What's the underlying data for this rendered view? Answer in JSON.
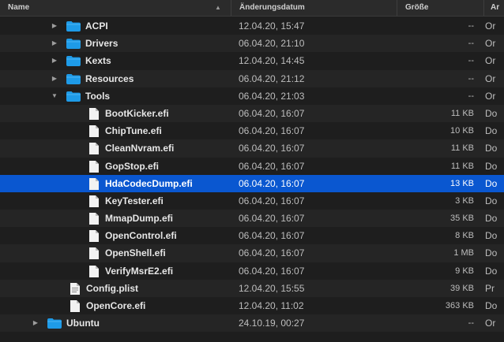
{
  "header": {
    "name": "Name",
    "date": "Änderungsdatum",
    "size": "Größe",
    "kind": "Ar"
  },
  "colors": {
    "background": "#1e1e1e",
    "selection": "#0a57d0",
    "folder": "#1e9be8"
  },
  "rows": [
    {
      "name": "ACPI",
      "date": "12.04.20, 15:47",
      "size": "--",
      "kind": "Or",
      "icon": "folder-icon",
      "disclosure": "collapsed"
    },
    {
      "name": "Drivers",
      "date": "06.04.20, 21:10",
      "size": "--",
      "kind": "Or",
      "icon": "folder-icon",
      "disclosure": "collapsed"
    },
    {
      "name": "Kexts",
      "date": "12.04.20, 14:45",
      "size": "--",
      "kind": "Or",
      "icon": "folder-icon",
      "disclosure": "collapsed"
    },
    {
      "name": "Resources",
      "date": "06.04.20, 21:12",
      "size": "--",
      "kind": "Or",
      "icon": "folder-icon",
      "disclosure": "collapsed"
    },
    {
      "name": "Tools",
      "date": "06.04.20, 21:03",
      "size": "--",
      "kind": "Or",
      "icon": "folder-icon",
      "disclosure": "expanded"
    },
    {
      "name": "BootKicker.efi",
      "date": "06.04.20, 16:07",
      "size": "11 KB",
      "kind": "Do",
      "icon": "document-icon"
    },
    {
      "name": "ChipTune.efi",
      "date": "06.04.20, 16:07",
      "size": "10 KB",
      "kind": "Do",
      "icon": "document-icon"
    },
    {
      "name": "CleanNvram.efi",
      "date": "06.04.20, 16:07",
      "size": "11 KB",
      "kind": "Do",
      "icon": "document-icon"
    },
    {
      "name": "GopStop.efi",
      "date": "06.04.20, 16:07",
      "size": "11 KB",
      "kind": "Do",
      "icon": "document-icon"
    },
    {
      "name": "HdaCodecDump.efi",
      "date": "06.04.20, 16:07",
      "size": "13 KB",
      "kind": "Do",
      "icon": "document-icon",
      "selected": true
    },
    {
      "name": "KeyTester.efi",
      "date": "06.04.20, 16:07",
      "size": "3 KB",
      "kind": "Do",
      "icon": "document-icon"
    },
    {
      "name": "MmapDump.efi",
      "date": "06.04.20, 16:07",
      "size": "35 KB",
      "kind": "Do",
      "icon": "document-icon"
    },
    {
      "name": "OpenControl.efi",
      "date": "06.04.20, 16:07",
      "size": "8 KB",
      "kind": "Do",
      "icon": "document-icon"
    },
    {
      "name": "OpenShell.efi",
      "date": "06.04.20, 16:07",
      "size": "1 MB",
      "kind": "Do",
      "icon": "document-icon"
    },
    {
      "name": "VerifyMsrE2.efi",
      "date": "06.04.20, 16:07",
      "size": "9 KB",
      "kind": "Do",
      "icon": "document-icon"
    },
    {
      "name": "Config.plist",
      "date": "12.04.20, 15:55",
      "size": "39 KB",
      "kind": "Pr",
      "icon": "plist-document-icon"
    },
    {
      "name": "OpenCore.efi",
      "date": "12.04.20, 11:02",
      "size": "363 KB",
      "kind": "Do",
      "icon": "document-icon"
    },
    {
      "name": "Ubuntu",
      "date": "24.10.19, 00:27",
      "size": "--",
      "kind": "Or",
      "icon": "folder-icon",
      "disclosure": "collapsed"
    }
  ]
}
